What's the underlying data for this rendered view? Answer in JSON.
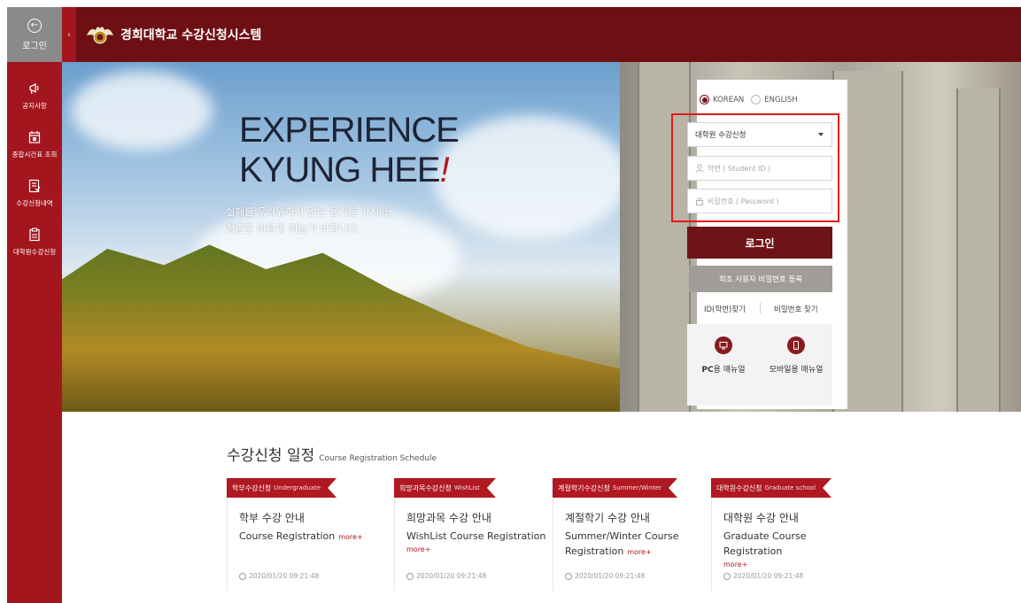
{
  "sidebar": {
    "login_label": "로그인",
    "items": [
      {
        "label": "공지사항",
        "icon": "megaphone-icon"
      },
      {
        "label": "종합시간표 조회",
        "icon": "calendar-icon"
      },
      {
        "label": "수강신청내역",
        "icon": "checklist-icon"
      },
      {
        "label": "대학원수강신청",
        "icon": "clipboard-icon"
      }
    ],
    "collapse_glyph": "‹"
  },
  "header": {
    "title": "경희대학교 수강신청시스템"
  },
  "hero": {
    "title_line1": "EXPERIENCE",
    "title_line2": "KYUNG HEE",
    "title_bang": "!",
    "subtitle_line1": "실패를 두려워하지 않는 용기를 가지고,",
    "subtitle_line2": "청춘은 마음껏 뛰놀기 바랍니다."
  },
  "login": {
    "lang_korean": "KOREAN",
    "lang_english": "ENGLISH",
    "select_value": "대학원 수강신청",
    "student_id_placeholder": "학번 ( Student ID )",
    "password_placeholder": "비밀번호 ( Password )",
    "login_button": "로그인",
    "first_user_button": "최초 사용자 비밀번호 등록",
    "find_id": "ID(학번)찾기",
    "find_pw": "비밀번호 찾기",
    "pc_manual_bold": "PC",
    "pc_manual_rest": "용 매뉴얼",
    "mobile_manual": "모바일용 매뉴얼"
  },
  "schedule": {
    "title_ko": "수강신청 일정",
    "title_en": "Course Registration Schedule",
    "cards": [
      {
        "tag": "학부수강신청",
        "tag_en": "Undergraduate",
        "title_ko": "학부 수강 안내",
        "title_en": "Course Registration",
        "more": "more+",
        "date": "2020/01/20 09:21:48"
      },
      {
        "tag": "희망과목수강신청",
        "tag_en": "WishList",
        "title_ko": "희망과목 수강 안내",
        "title_en": "WishList Course Registration",
        "more": "more+",
        "date": "2020/01/20 09:21:48"
      },
      {
        "tag": "계절학기수강신청",
        "tag_en": "Summer/Winter",
        "title_ko": "계절학기 수강 안내",
        "title_en1": "Summer/Winter Course",
        "title_en2": "Registration",
        "more": "more+",
        "date": "2020/01/20 09:21:48"
      },
      {
        "tag": "대학원수강신청",
        "tag_en": "Graduate school",
        "title_ko": "대학원 수강 안내",
        "title_en": "Graduate Course Registration",
        "more": "more+",
        "date": "2020/01/20 09:21:48"
      }
    ]
  },
  "colors": {
    "sidebar": "#a3161d",
    "header": "#6e0f14",
    "login_button": "#6e1317",
    "highlight_box": "#e01b1b"
  }
}
